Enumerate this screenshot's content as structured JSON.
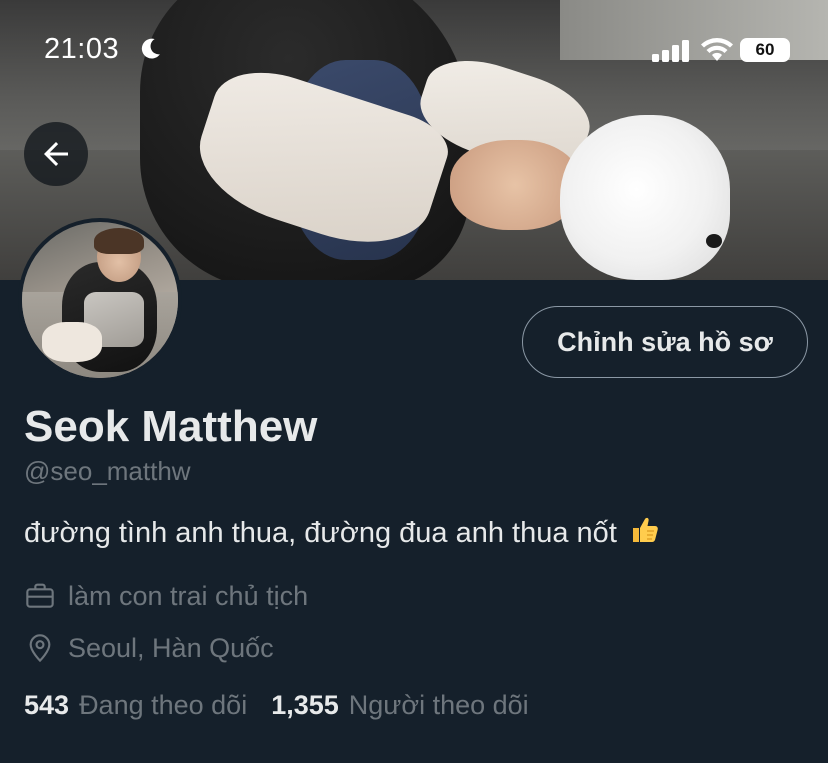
{
  "status_bar": {
    "time": "21:03",
    "battery": "60"
  },
  "icons": {
    "back": "arrow-left-icon",
    "moon": "moon-icon",
    "signal": "signal-icon",
    "wifi": "wifi-icon",
    "battery": "battery-icon",
    "job": "briefcase-icon",
    "location": "location-pin-icon",
    "thumbs": "thumbs-up-emoji"
  },
  "profile": {
    "name": "Seok Matthew",
    "handle": "@seo_matthw",
    "bio": "đường tình anh thua, đường đua anh thua nốt",
    "job": "làm con trai chủ tịch",
    "location": "Seoul, Hàn Quốc",
    "following_count": "543",
    "following_label": "Đang theo dõi",
    "followers_count": "1,355",
    "followers_label": "Người theo dõi"
  },
  "actions": {
    "edit_profile": "Chỉnh sửa hồ sơ"
  },
  "colors": {
    "background": "#15202b",
    "primary_text": "#e7e9ea",
    "secondary_text": "#6e767d",
    "button_border": "#8b98a5"
  }
}
